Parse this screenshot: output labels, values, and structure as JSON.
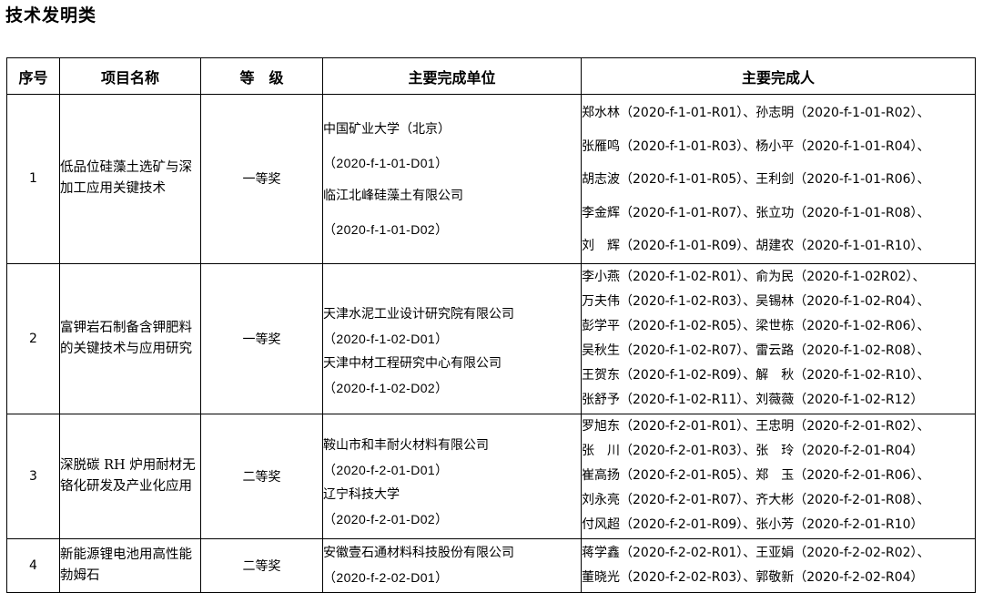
{
  "title": "技术发明类",
  "headers": {
    "index": "序号",
    "name": "项目名称",
    "grade": "等　级",
    "units": "主要完成单位",
    "people": "主要完成人"
  },
  "rows": [
    {
      "index": "1",
      "name": "低品位硅藻土选矿与深加工应用关键技术",
      "grade": "一等奖",
      "units": [
        "中国矿业大学（北京）",
        "（2020-f-1-01-D01）",
        "临江北峰硅藻土有限公司",
        "（2020-f-1-01-D02）"
      ],
      "people": [
        "郑水林（2020-f-1-01-R01）、孙志明（2020-f-1-01-R02）、",
        "张雁鸣（2020-f-1-01-R03）、杨小平（2020-f-1-01-R04）、",
        "胡志波（2020-f-1-01-R05）、王利剑（2020-f-1-01-R06）、",
        "李金辉（2020-f-1-01-R07）、张立功（2020-f-1-01-R08）、",
        "刘　辉（2020-f-1-01-R09）、胡建农（2020-f-1-01-R10）、"
      ]
    },
    {
      "index": "2",
      "name": "富钾岩石制备含钾肥料的关键技术与应用研究",
      "grade": "一等奖",
      "units": [
        "天津水泥工业设计研究院有限公司",
        "（2020-f-1-02-D01）",
        "天津中材工程研究中心有限公司",
        "（2020-f-1-02-D02）"
      ],
      "people": [
        "李小燕（2020-f-1-02-R01）、俞为民（2020-f-1-02R02）、",
        "万夫伟（2020-f-1-02-R03）、吴锡林（2020-f-1-02-R04）、",
        "彭学平（2020-f-1-02-R05）、梁世栋（2020-f-1-02-R06）、",
        "吴秋生（2020-f-1-02-R07）、雷云路（2020-f-1-02-R08）、",
        "王贺东（2020-f-1-02-R09）、解　秋（2020-f-1-02-R10）、",
        "张舒予（2020-f-1-02-R11）、刘薇薇（2020-f-1-02-R12）"
      ]
    },
    {
      "index": "3",
      "name": "深脱碳 RH 炉用耐材无铬化研发及产业化应用",
      "grade": "二等奖",
      "units": [
        "鞍山市和丰耐火材料有限公司",
        "（2020-f-2-01-D01）",
        "辽宁科技大学",
        "（2020-f-2-01-D02）"
      ],
      "people": [
        "罗旭东（2020-f-2-01-R01）、王忠明（2020-f-2-01-R02）、",
        "张　川（2020-f-2-01-R03）、张　玲（2020-f-2-01-R04）",
        "崔高扬（2020-f-2-01-R05）、郑　玉（2020-f-2-01-R06）、",
        "刘永亮（2020-f-2-01-R07）、齐大彬（2020-f-2-01-R08）、",
        "付风超（2020-f-2-01-R09）、张小芳（2020-f-2-01-R10）"
      ]
    },
    {
      "index": "4",
      "name": "新能源锂电池用高性能勃姆石",
      "grade": "二等奖",
      "units": [
        "安徽壹石通材料科技股份有限公司",
        "（2020-f-2-02-D01）"
      ],
      "people": [
        "蒋学鑫（2020-f-2-02-R01）、王亚娟（2020-f-2-02-R02）、",
        "董晓光（2020-f-2-02-R03）、郭敬新（2020-f-2-02-R04）"
      ]
    }
  ]
}
